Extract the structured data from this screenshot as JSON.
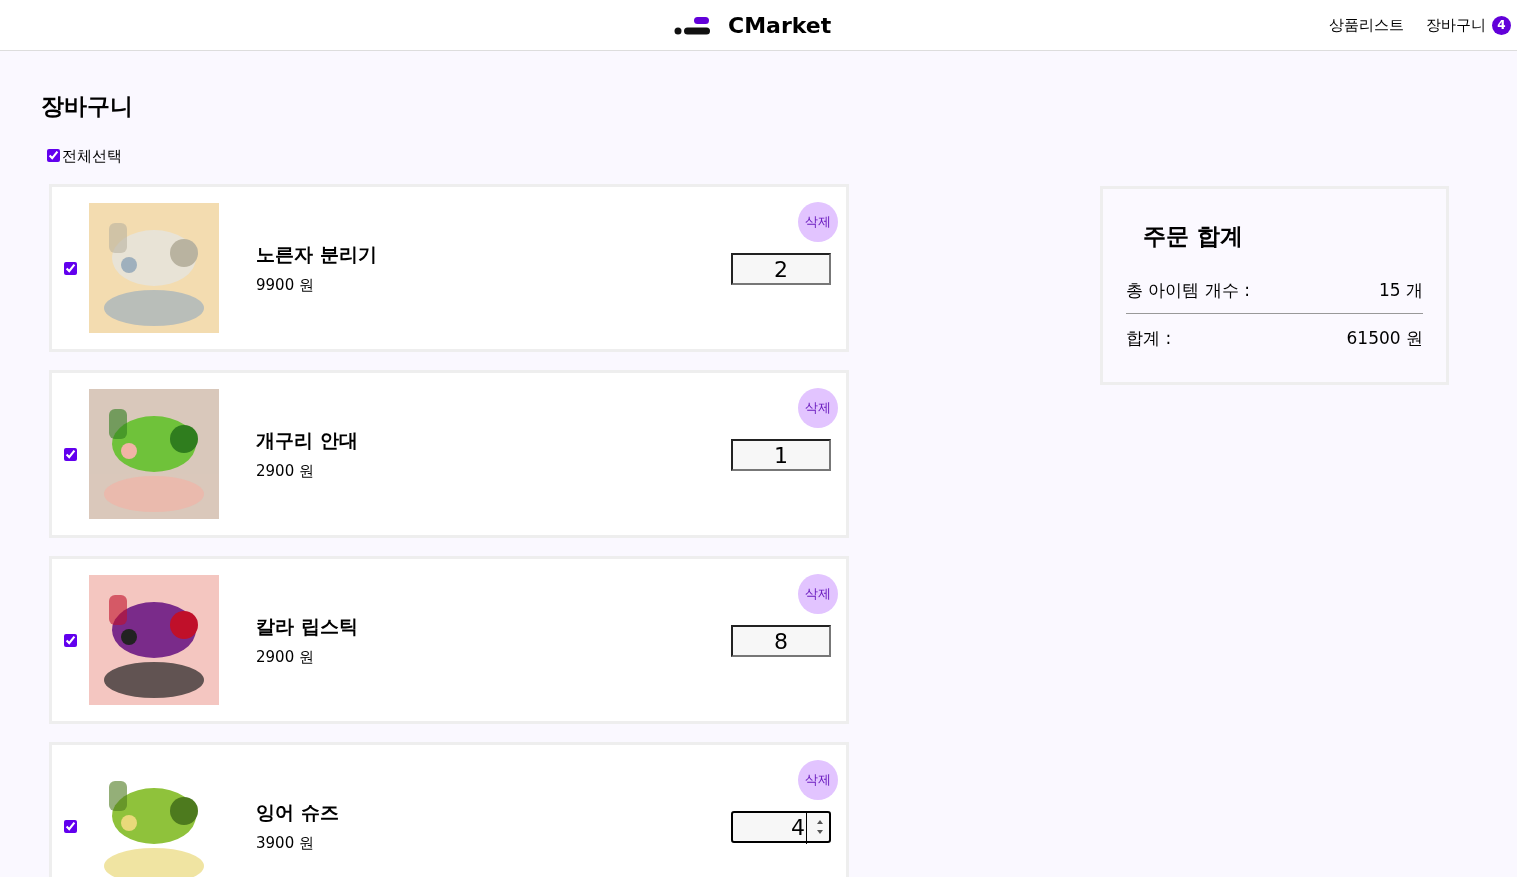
{
  "header": {
    "logo_text": "CMarket",
    "nav": [
      {
        "label": "상품리스트"
      },
      {
        "label": "장바구니",
        "badge": "4"
      }
    ]
  },
  "page_title": "장바구니",
  "select_all": {
    "label": "전체선택",
    "checked": true
  },
  "items": [
    {
      "checked": true,
      "name": "노른자 분리기",
      "price": "9900 원",
      "delete_label": "삭제",
      "quantity": "2",
      "focused": false
    },
    {
      "checked": true,
      "name": "개구리 안대",
      "price": "2900 원",
      "delete_label": "삭제",
      "quantity": "1",
      "focused": false
    },
    {
      "checked": true,
      "name": "칼라 립스틱",
      "price": "2900 원",
      "delete_label": "삭제",
      "quantity": "8",
      "focused": false
    },
    {
      "checked": true,
      "name": "잉어 슈즈",
      "price": "3900 원",
      "delete_label": "삭제",
      "quantity": "4",
      "focused": true
    }
  ],
  "summary": {
    "title": "주문 합계",
    "rows": [
      {
        "label": "총 아이템 개수 :",
        "value": "15 개"
      },
      {
        "label": "합계 :",
        "value": "61500 원"
      }
    ]
  }
}
